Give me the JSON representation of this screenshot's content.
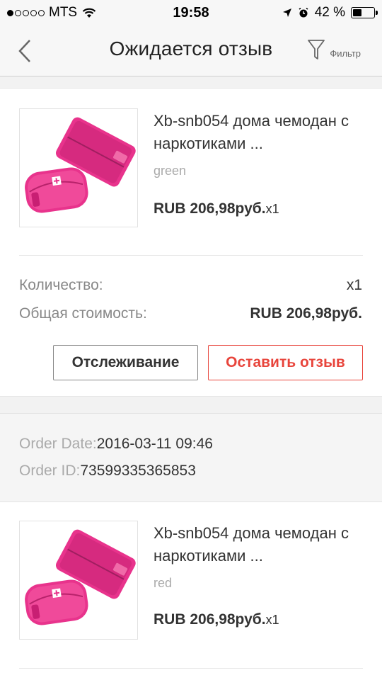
{
  "status_bar": {
    "carrier": "MTS",
    "time": "19:58",
    "battery": "42 %",
    "battery_level": 0.42,
    "signal_bars_filled": 1
  },
  "nav": {
    "title": "Ожидается отзыв",
    "filter_label": "Фильтр",
    "icons": {
      "back": "chevron-left-icon",
      "filter": "funnel-icon"
    }
  },
  "orders": [
    {
      "product": {
        "title": "Xb-snb054 дома чемодан с наркотиками ...",
        "color": "green",
        "price": "RUB 206,98руб.",
        "qty": "x1"
      },
      "summary": {
        "quantity_label": "Количество:",
        "quantity_value": "x1",
        "total_label": "Общая стоимость:",
        "total_value": "RUB 206,98руб."
      },
      "buttons": {
        "track": "Отслеживание",
        "review": "Оставить отзыв"
      }
    },
    {
      "order_date_label": "Order Date:",
      "order_date": "2016-03-11 09:46",
      "order_id_label": "Order ID:",
      "order_id": "73599335365853",
      "product": {
        "title": "Xb-snb054 дома чемодан с наркотиками ...",
        "color": "red",
        "price": "RUB 206,98руб.",
        "qty": "x1"
      }
    }
  ],
  "colors": {
    "accent": "#e8453c",
    "product_pink": "#e8338c"
  }
}
